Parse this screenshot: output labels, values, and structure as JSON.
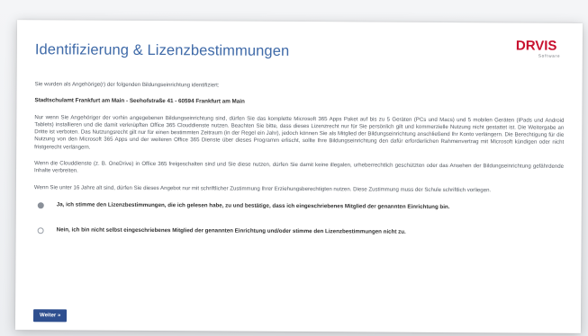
{
  "header": {
    "title": "Identifizierung & Lizenzbestimmungen",
    "logo_text": "DRVIS",
    "logo_subtext": "Software"
  },
  "content": {
    "identified_text": "Sie wurden als Angehörige(r) der folgenden Bildungseinrichtung identifiziert:",
    "institution": "Stadtschulamt Frankfurt am Main - Seehofstraße 41 - 60594 Frankfurt am Main",
    "paragraphs": [
      "Nur wenn Sie Angehöriger der vorhin angegebenen Bildungseinrichtung sind, dürfen Sie das komplette Microsoft 365 Apps Paket auf bis zu 5 Geräten (PCs und Macs) und 5 mobilen Geräten (iPads und Android Tablets) installieren und die damit verknüpften Office 365 Clouddienste nutzen. Beachten Sie bitte, dass dieses Lizenzrecht nur für Sie persönlich gilt und kommerzielle Nutzung nicht gestattet ist. Die Weitergabe an Dritte ist verboten. Das Nutzungsrecht gilt nur für einen bestimmten Zeitraum (in der Regel ein Jahr), jedoch können Sie als Mitglied der Bildungseinrichtung anschließend Ihr Konto verlängern. Die Berechtigung für die Nutzung von den Microsoft 365 Apps und der weiteren Office 365 Dienste über dieses Programm erlischt, sollte Ihre Bildungseinrichtung den dafür erforderlichen Rahmenvertrag mit Microsoft kündigen oder nicht fristgerecht verlängern.",
      "Wenn die Clouddienste (z. B. OneDrive) in Office 365 freigeschalten sind und Sie diese nutzen, dürfen Sie damit keine illegalen, urheberrechtlich geschützten oder das Ansehen der Bildungseinrichtung gefährdende Inhalte verbreiten.",
      "Wenn Sie unter 16 Jahre alt sind, dürfen Sie dieses Angebot nur mit schriftlicher Zustimmung Ihrer Erziehungsberechtigten nutzen. Diese Zustimmung muss der Schule schriftlich vorliegen."
    ]
  },
  "options": {
    "accept": {
      "label": "Ja, ich stimme den Lizenzbestimmungen, die ich gelesen habe, zu und bestätige, dass ich eingeschriebenes Mitglied der genannten Einrichtung bin.",
      "selected": true
    },
    "decline": {
      "label": "Nein, ich bin nicht selbst eingeschriebenes Mitglied der genannten Einrichtung und/oder stimme den Lizenzbestimmungen nicht zu.",
      "selected": false
    }
  },
  "actions": {
    "next_label": "Weiter »"
  },
  "colors": {
    "title": "#3f6aa8",
    "button": "#2e4f8f",
    "logo_red": "#c8102e",
    "logo_gray": "#6b6f75"
  }
}
